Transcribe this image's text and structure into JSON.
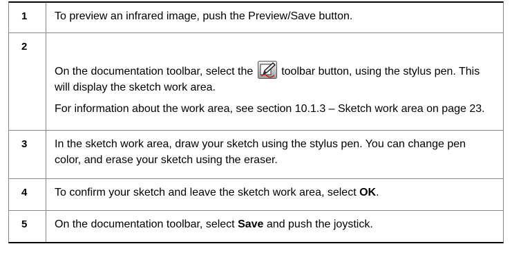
{
  "steps": [
    {
      "number": "1",
      "text": "To preview an infrared image, push the Preview/Save button."
    },
    {
      "number": "2",
      "text_before_icon": "On the documentation toolbar, select the",
      "icon": "sketch-pencil-icon",
      "text_after_icon": "toolbar button, using the stylus pen. This will display the sketch work area.",
      "note": "For information about the work area, see section 10.1.3 – Sketch work area on page 23."
    },
    {
      "number": "3",
      "text": "In the sketch work area, draw your sketch using the stylus pen. You can change pen color, and erase your sketch using the eraser."
    },
    {
      "number": "4",
      "text_before_bold": "To confirm your sketch and leave the sketch work area, select",
      "bold": "OK",
      "text_after_bold": "."
    },
    {
      "number": "5",
      "text_before_bold": "On the documentation toolbar, select",
      "bold": "Save",
      "text_after_bold": "and push the joystick."
    }
  ]
}
